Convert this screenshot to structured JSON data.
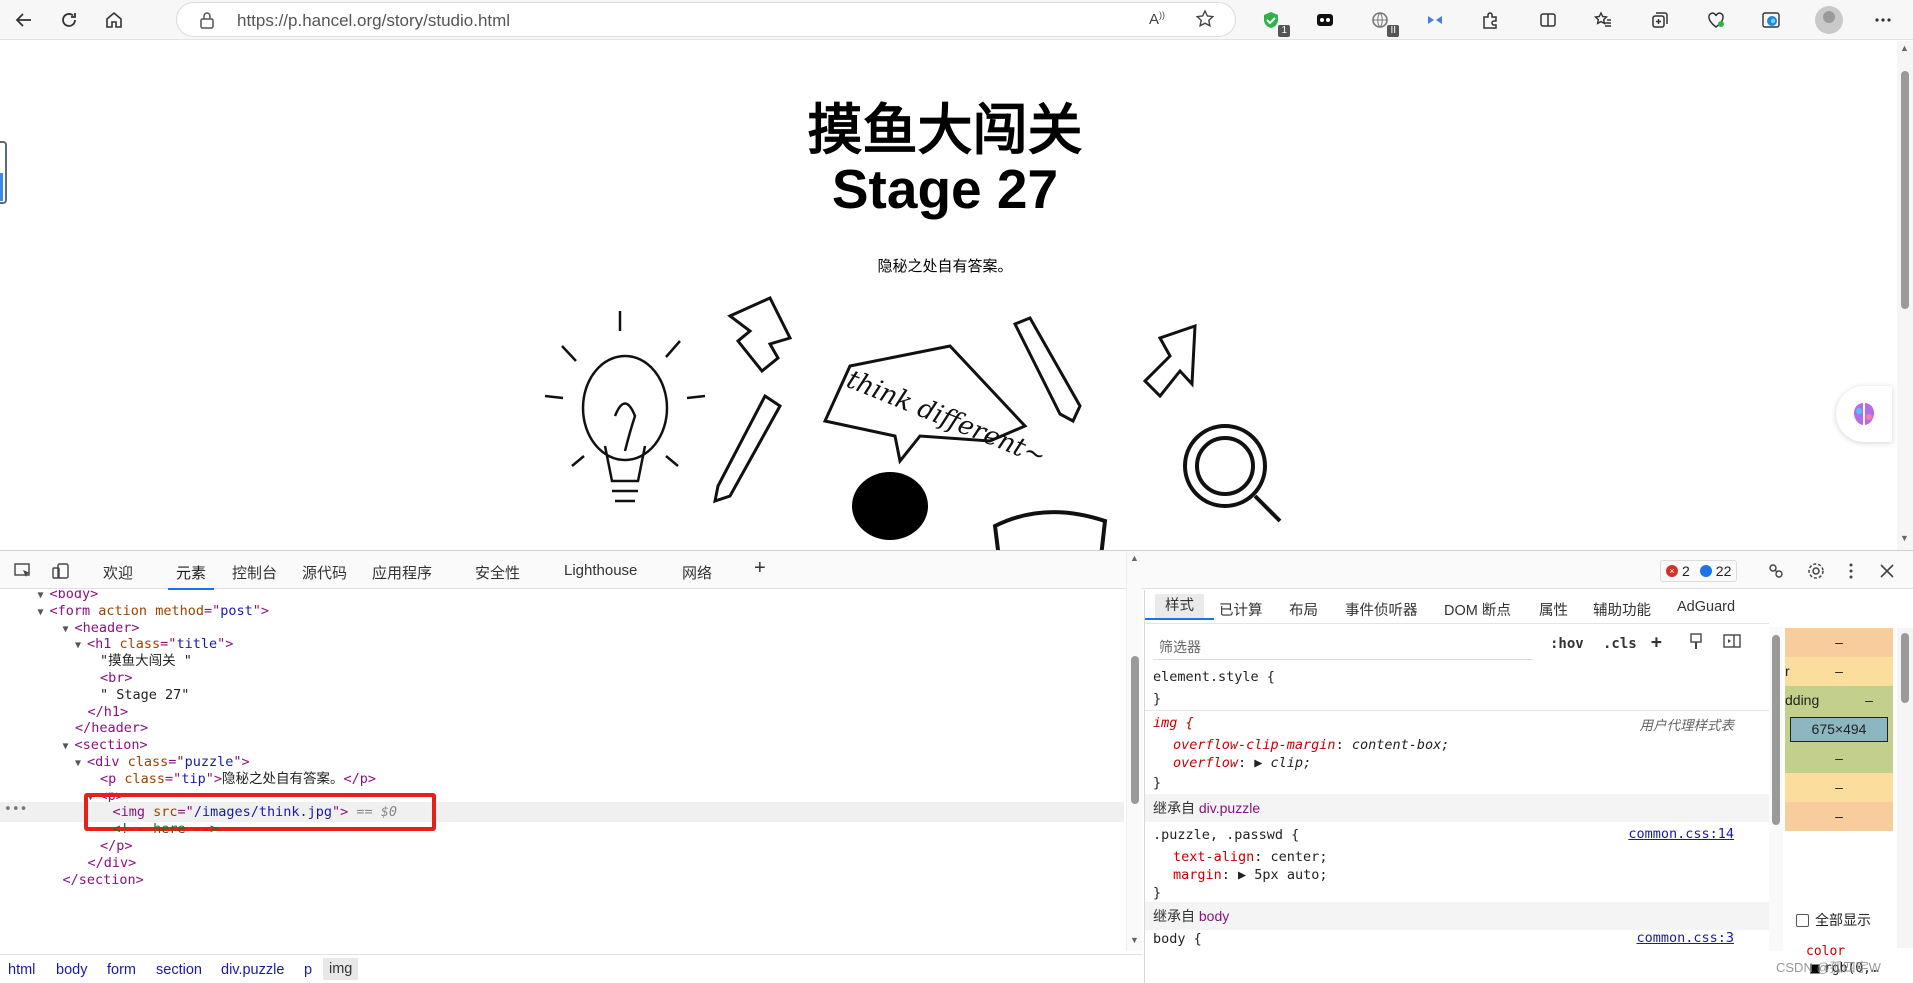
{
  "browser": {
    "url": "https://p.hancel.org/story/studio.html",
    "read_aloud_label": "A",
    "ext_badges": [
      "1",
      "II"
    ],
    "icons": [
      "back-icon",
      "refresh-icon",
      "home-icon",
      "lock-icon",
      "read-aloud-icon",
      "favorite-star-icon",
      "shield-extension-icon",
      "mask-extension-icon",
      "globe-extension-icon",
      "bowtie-extension-icon",
      "puzzle-extension-icon",
      "split-screen-icon",
      "favorites-list-icon",
      "collections-icon",
      "heart-pulse-icon",
      "edge-icon",
      "profile-avatar-icon",
      "more-menu-icon"
    ]
  },
  "page": {
    "title_line1": "摸鱼大闯关",
    "title_line2": "Stage 27",
    "tip": "隐秘之处自有答案。",
    "art_text": "think different~"
  },
  "devtools": {
    "tabs": [
      "欢迎",
      "元素",
      "控制台",
      "源代码",
      "应用程序",
      "安全性",
      "Lighthouse",
      "网络"
    ],
    "active_tab": "元素",
    "error_count": "2",
    "message_count": "22",
    "elements": {
      "lines": [
        {
          "indent": 3,
          "tri": "▼",
          "open": "body",
          "partial": true
        },
        {
          "indent": 3,
          "tri": "▼",
          "tag": "form",
          "attrs": [
            {
              "n": "action",
              "v": null
            },
            {
              "n": "method",
              "v": "post"
            }
          ]
        },
        {
          "indent": 5,
          "tri": "▼",
          "tag": "header",
          "attrs": []
        },
        {
          "indent": 6,
          "tri": "▼",
          "tag": "h1",
          "attrs": [
            {
              "n": "class",
              "v": "title"
            }
          ]
        },
        {
          "indent": 8,
          "text": "\"摸鱼大闯关 \""
        },
        {
          "indent": 8,
          "selfclose": "br"
        },
        {
          "indent": 8,
          "text": "\" Stage 27\""
        },
        {
          "indent": 7,
          "close": "h1"
        },
        {
          "indent": 6,
          "close": "header"
        },
        {
          "indent": 5,
          "tri": "▼",
          "tag": "section",
          "attrs": []
        },
        {
          "indent": 6,
          "tri": "▼",
          "tag": "div",
          "attrs": [
            {
              "n": "class",
              "v": "puzzle"
            }
          ]
        },
        {
          "indent": 8,
          "inline_p": true,
          "attrs": [
            {
              "n": "class",
              "v": "tip"
            }
          ],
          "inner": "隐秘之处自有答案。"
        },
        {
          "indent": 7,
          "tri": "▼",
          "tag": "p",
          "attrs": []
        },
        {
          "indent": 9,
          "img": true,
          "attrs": [
            {
              "n": "src",
              "v": "/images/think.jpg"
            }
          ],
          "dollar": "== $0",
          "selected": true
        },
        {
          "indent": 9,
          "comment": "<!-- here -->"
        },
        {
          "indent": 8,
          "close": "p"
        },
        {
          "indent": 7,
          "close": "div"
        },
        {
          "indent": 5,
          "close": "section"
        }
      ]
    },
    "breadcrumbs": [
      "html",
      "body",
      "form",
      "section",
      "div.puzzle",
      "p",
      "img"
    ],
    "styles": {
      "tabs": [
        "样式",
        "已计算",
        "布局",
        "事件侦听器",
        "DOM 断点",
        "属性",
        "辅助功能",
        "AdGuard"
      ],
      "active_tab": "样式",
      "filter_placeholder": "筛选器",
      "hov": ":hov",
      "cls": ".cls",
      "element_style_open": "element.style {",
      "close_brace": "}",
      "rule1_selector": "img {",
      "rule1_source": "用户代理样式表",
      "rule1_props": [
        {
          "name": "overflow-clip-margin",
          "value": "content-box;"
        },
        {
          "name": "overflow",
          "value": "▶ clip;"
        }
      ],
      "inherit1_label": "继承自",
      "inherit1_ref": "div.puzzle",
      "rule2_selector": ".puzzle, .passwd {",
      "rule2_source": "common.css:14",
      "rule2_props": [
        {
          "name": "text-align",
          "value": "center;"
        },
        {
          "name": "margin",
          "value": "▶ 5px auto;"
        }
      ],
      "inherit2_label": "继承自",
      "inherit2_ref": "body",
      "rule3_selector": "body {",
      "rule3_source": "common.css:3"
    },
    "boxmodel": {
      "rows": [
        "–",
        "–",
        "–",
        "–",
        "–",
        "–"
      ],
      "labels": [
        "r",
        "dding"
      ],
      "content": "675×494",
      "show_all": "全部显示",
      "color_prop": "color",
      "color_value": "rgb(0,…"
    },
    "watermark": "CSDN @孤四宇W"
  }
}
